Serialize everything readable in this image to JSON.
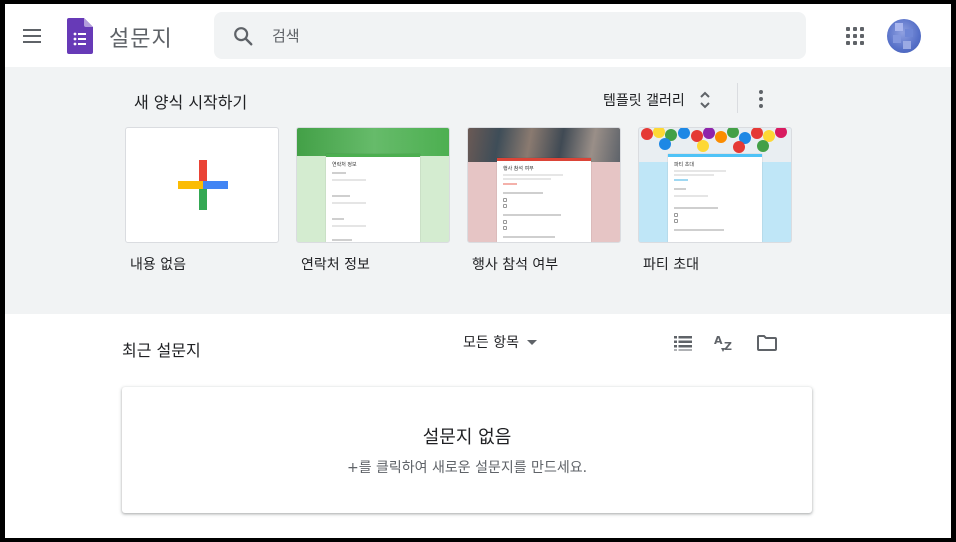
{
  "header": {
    "app_title": "설문지",
    "search_placeholder": "검색"
  },
  "templates": {
    "section_title": "새 양식 시작하기",
    "gallery_label": "템플릿 갤러리",
    "cards": [
      {
        "label": "내용 없음"
      },
      {
        "label": "연락처 정보",
        "doc_title": "연락처 정보"
      },
      {
        "label": "행사 참석 여부",
        "doc_title": "행사 참석 여부"
      },
      {
        "label": "파티 초대",
        "doc_title": "파티 초대"
      }
    ]
  },
  "recent": {
    "title": "최근 설문지",
    "filter_label": "모든 항목",
    "empty_title": "설문지 없음",
    "empty_subtitle": "+를 클릭하여 새로운 설문지를 만드세요."
  },
  "colors": {
    "forms_purple": "#673ab7",
    "contact_green": "#4caf50",
    "event_red": "#db4437",
    "party_blue": "#4fc3f7",
    "section_bg": "#f1f3f4"
  }
}
